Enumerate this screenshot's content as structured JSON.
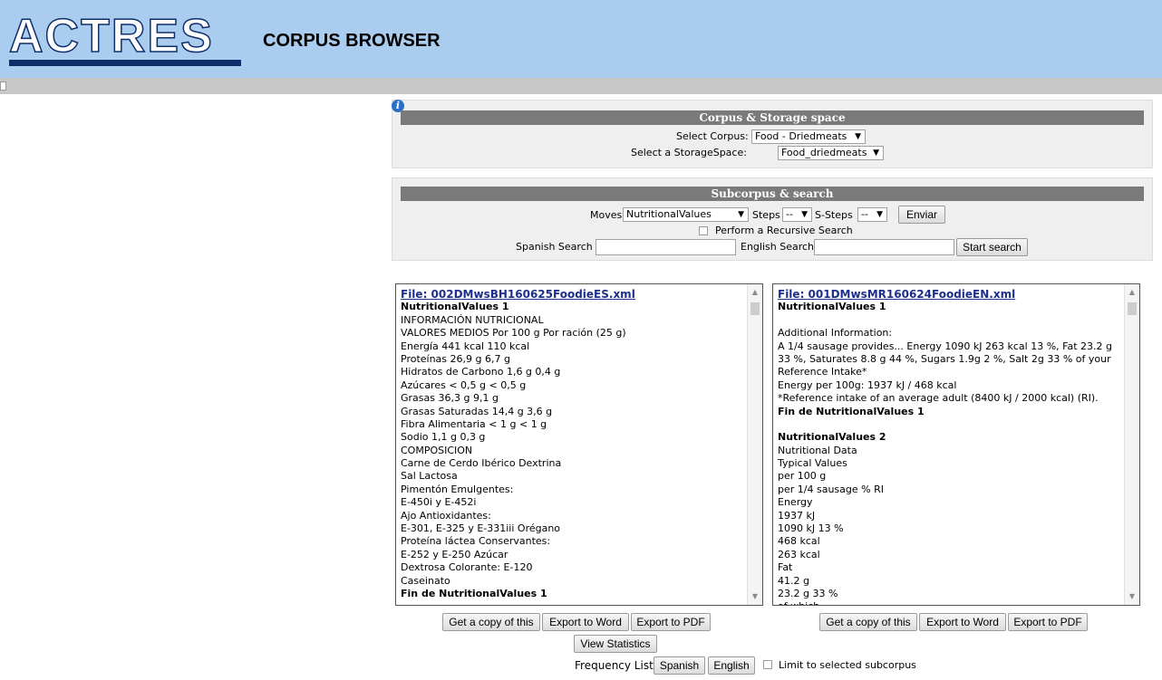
{
  "header": {
    "logo_text": "ACTRES",
    "app_title": "CORPUS BROWSER"
  },
  "info_icon": "i",
  "corpus_panel": {
    "title": "Corpus & Storage space",
    "select_corpus_label": "Select Corpus:",
    "select_corpus_value": "Food - Driedmeats",
    "select_storage_label": "Select a StorageSpace:",
    "select_storage_value": "Food_driedmeats"
  },
  "search_panel": {
    "title": "Subcorpus & search",
    "moves_label": "Moves",
    "moves_value": "NutritionalValues",
    "steps_label": "Steps",
    "steps_value": "--",
    "ssteps_label": "S-Steps",
    "ssteps_value": "--",
    "enviar_label": "Enviar",
    "recursive_label": "Perform a Recursive Search",
    "spanish_search_label": "Spanish Search",
    "english_search_label": "English Search",
    "start_search_label": "Start search"
  },
  "left_doc": {
    "file": "File: 002DMwsBH160625FoodieES.xml",
    "lines": [
      {
        "t": "NutritionalValues 1",
        "b": true
      },
      {
        "t": "INFORMACIÓN NUTRICIONAL"
      },
      {
        "t": "VALORES MEDIOS Por 100 g Por ración (25 g)"
      },
      {
        "t": "Energía 441 kcal 110 kcal"
      },
      {
        "t": "Proteínas 26,9 g 6,7 g"
      },
      {
        "t": "Hidratos de Carbono 1,6 g 0,4 g"
      },
      {
        "t": "Azúcares < 0,5 g < 0,5 g"
      },
      {
        "t": "Grasas 36,3 g 9,1 g"
      },
      {
        "t": "Grasas Saturadas 14,4 g 3,6 g"
      },
      {
        "t": "Fibra Alimentaria < 1 g < 1 g"
      },
      {
        "t": "Sodio 1,1 g 0,3 g"
      },
      {
        "t": "COMPOSICION"
      },
      {
        "t": "Carne de Cerdo Ibérico Dextrina"
      },
      {
        "t": "Sal Lactosa"
      },
      {
        "t": "Pimentón Emulgentes:"
      },
      {
        "t": "E-450i y E-452i"
      },
      {
        "t": "Ajo Antioxidantes:"
      },
      {
        "t": "E-301, E-325 y E-331iii Orégano"
      },
      {
        "t": "Proteína láctea Conservantes:"
      },
      {
        "t": "E-252 y E-250 Azúcar"
      },
      {
        "t": "Dextrosa Colorante: E-120"
      },
      {
        "t": "Caseinato"
      },
      {
        "t": "Fin de NutritionalValues 1",
        "b": true
      }
    ]
  },
  "right_doc": {
    "file": "File: 001DMwsMR160624FoodieEN.xml",
    "lines": [
      {
        "t": "NutritionalValues 1",
        "b": true
      },
      {
        "t": ""
      },
      {
        "t": "Additional Information:"
      },
      {
        "t": "A 1/4 sausage provides... Energy 1090 kJ 263 kcal 13 %, Fat 23.2 g"
      },
      {
        "t": "33 %, Saturates 8.8 g 44 %, Sugars 1.9g 2 %, Salt 2g 33 % of your"
      },
      {
        "t": "Reference Intake*"
      },
      {
        "t": "Energy per 100g: 1937 kJ / 468 kcal"
      },
      {
        "t": "*Reference intake of an average adult (8400 kJ / 2000 kcal) (RI)."
      },
      {
        "t": "Fin de NutritionalValues 1",
        "b": true
      },
      {
        "t": ""
      },
      {
        "t": "NutritionalValues 2",
        "b": true
      },
      {
        "t": "Nutritional Data"
      },
      {
        "t": "Typical Values"
      },
      {
        "t": "per 100 g"
      },
      {
        "t": "per 1/4 sausage % RI"
      },
      {
        "t": "Energy"
      },
      {
        "t": "1937 kJ"
      },
      {
        "t": "1090 kJ 13 %"
      },
      {
        "t": "468 kcal"
      },
      {
        "t": "263 kcal"
      },
      {
        "t": "Fat"
      },
      {
        "t": "41.2 g"
      },
      {
        "t": "23.2 g 33 %"
      },
      {
        "t": "of which"
      }
    ]
  },
  "actions": {
    "copy_label": "Get a copy of this",
    "word_label": "Export to Word",
    "pdf_label": "Export to PDF",
    "stats_label": "View Statistics",
    "freq_label": "Frequency List:",
    "spanish_label": "Spanish",
    "english_label": "English",
    "limit_label": "Limit to selected subcorpus"
  }
}
